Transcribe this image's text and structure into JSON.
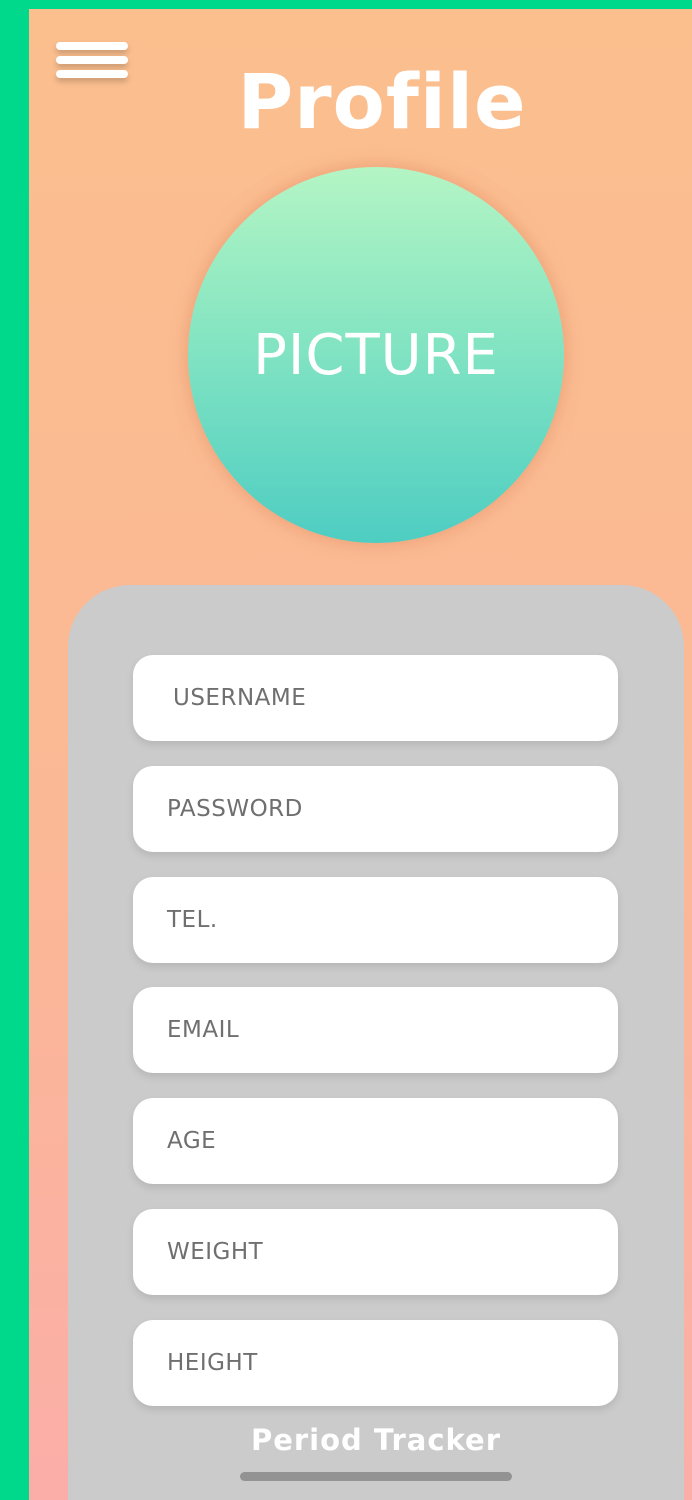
{
  "header": {
    "title": "Profile",
    "menu_icon": "hamburger-menu-icon"
  },
  "avatar": {
    "label": "PICTURE"
  },
  "form": {
    "fields": [
      {
        "placeholder": "USERNAME"
      },
      {
        "placeholder": "PASSWORD"
      },
      {
        "placeholder": "TEL."
      },
      {
        "placeholder": "EMAIL"
      },
      {
        "placeholder": "AGE"
      },
      {
        "placeholder": "WEIGHT"
      },
      {
        "placeholder": "HEIGHT"
      }
    ]
  },
  "footer": {
    "app_name": "Period Tracker"
  },
  "colors": {
    "frame": "#00d98b",
    "background_top": "#fbbf8e",
    "background_bottom": "#fbaea8",
    "avatar_top": "#b4f5c4",
    "avatar_bottom": "#4ecdc2",
    "panel": "#cbcbcb"
  }
}
